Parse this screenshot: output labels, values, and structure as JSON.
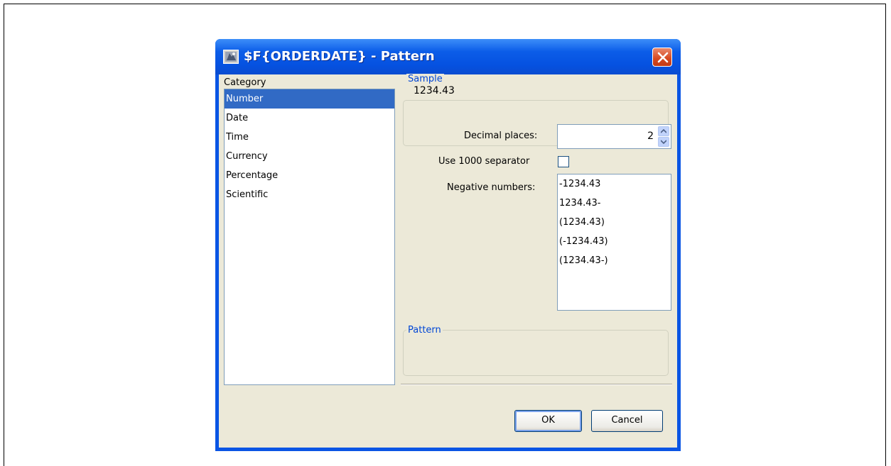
{
  "dialog": {
    "title": "$F{ORDERDATE} - Pattern"
  },
  "category": {
    "label": "Category",
    "items": [
      "Number",
      "Date",
      "Time",
      "Currency",
      "Percentage",
      "Scientific"
    ],
    "selected": "Number"
  },
  "sample": {
    "title": "Sample",
    "value": "1234.43"
  },
  "decimal_places": {
    "label": "Decimal places:",
    "value": "2"
  },
  "separator": {
    "label": "Use 1000 separator",
    "checked": false
  },
  "negative_numbers": {
    "label": "Negative numbers:",
    "items": [
      "-1234.43",
      "1234.43-",
      "(1234.43)",
      "(-1234.43)",
      "(1234.43-)"
    ]
  },
  "pattern": {
    "title": "Pattern",
    "value": ""
  },
  "buttons": {
    "ok": "OK",
    "cancel": "Cancel"
  },
  "colors": {
    "titlebar": "#0551e0",
    "selection": "#316ac5",
    "group_title": "#0046d5",
    "close_button": "#d6481f",
    "dialog_bg": "#ece9d8"
  },
  "icons": [
    "app-icon",
    "close-icon",
    "spin-up-icon",
    "spin-down-icon"
  ]
}
